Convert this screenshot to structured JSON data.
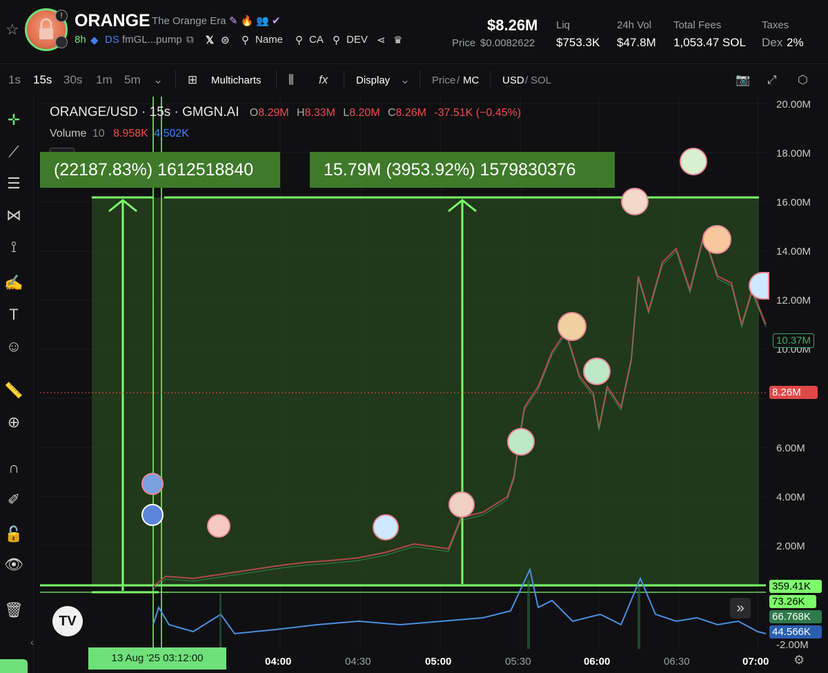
{
  "header": {
    "symbol": "ORANGE",
    "name": "The Orange Era",
    "age": "8h",
    "ds_label": "DS",
    "address": "fmGL...pump",
    "links": {
      "name": "Name",
      "ca": "CA",
      "dev": "DEV"
    },
    "market_cap": "$8.26M",
    "price_label": "Price",
    "price": "$0.0082622",
    "liq_label": "Liq",
    "liq": "$753.3K",
    "vol_label": "24h Vol",
    "vol": "$47.8M",
    "fees_label": "Total Fees",
    "fees": "1,053.47 SOL",
    "taxes_label": "Taxes",
    "dex_label": "Dex",
    "tax": "2%"
  },
  "toolbar": {
    "intervals": [
      "1s",
      "15s",
      "30s",
      "1m",
      "5m"
    ],
    "active_interval": "15s",
    "multicharts": "Multicharts",
    "display": "Display",
    "price_label": "Price",
    "mc_label": "MC",
    "usd_label": "USD",
    "sol_label": "SOL"
  },
  "chart": {
    "pair_line": "ORANGE/USD · 15s · GMGN.AI",
    "o_label": "O",
    "o": "8.29M",
    "h_label": "H",
    "h": "8.33M",
    "l_label": "L",
    "l": "8.20M",
    "c_label": "C",
    "c": "8.26M",
    "change": "-37.51K (−0.45%)",
    "volume_label": "Volume",
    "volume_len": "10",
    "volume_a": "8.958K",
    "volume_b": "4.502K",
    "measure_left": "(22187.83%) 1612518840",
    "measure_right": "15.79M (3953.92%) 1579830376",
    "price_tag_current": "8.26M",
    "price_tag_high": "10.37M",
    "tag_359": "359.41K",
    "tag_73": "73.26K",
    "tag_66": "66.768K",
    "tag_44": "44.566K",
    "y_ticks": [
      "20.00M",
      "18.00M",
      "16.00M",
      "14.00M",
      "12.00M",
      "10.00M",
      "6.00M",
      "4.00M",
      "2.00M",
      "-2.00M"
    ],
    "x_ticks": [
      "04:00",
      "04:30",
      "05:00",
      "05:30",
      "06:00",
      "06:30",
      "07:00"
    ],
    "date_label": "13 Aug '25   03:12:00",
    "tv_logo": "TV"
  },
  "colors": {
    "up": "#6fe07a",
    "down": "#f04b4b",
    "measure": "#3f7a2a",
    "accent": "#6fe07a"
  }
}
